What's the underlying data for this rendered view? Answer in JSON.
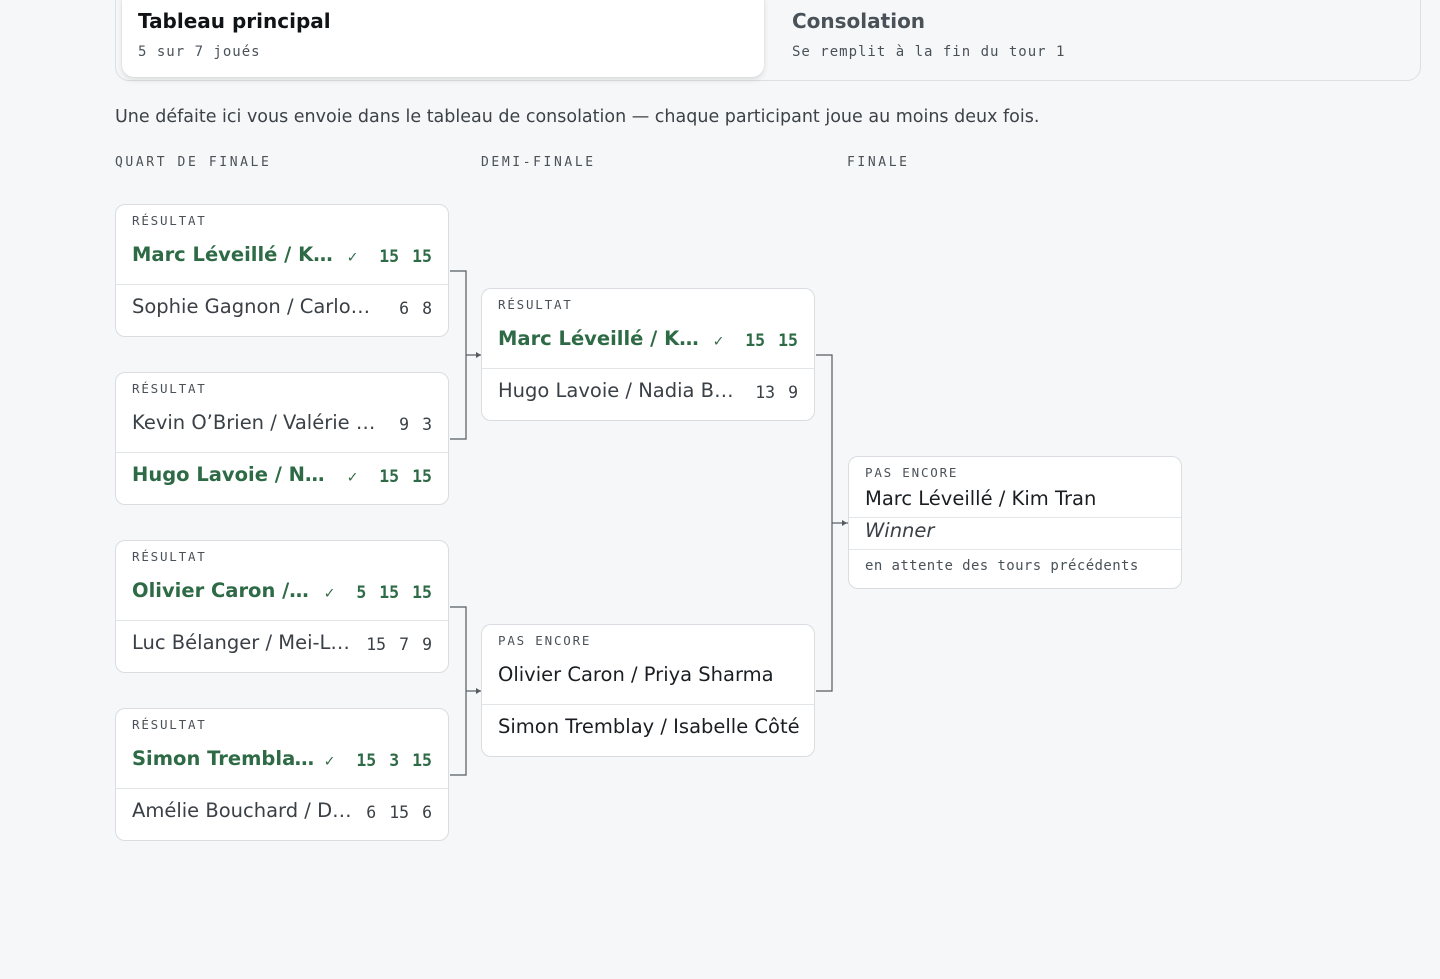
{
  "tabs": [
    {
      "title": "Tableau principal",
      "subtitle": "5 sur 7 joués"
    },
    {
      "title": "Consolation",
      "subtitle": "Se remplit à la fin du tour 1"
    }
  ],
  "note": "Une défaite ici vous envoie dans le tableau de consolation — chaque participant joue au moins deux fois.",
  "rounds": [
    "QUART DE FINALE",
    "DEMI-FINALE",
    "FINALE"
  ],
  "quarterfinals": [
    {
      "status": "RÉSULTAT",
      "team1": {
        "name": "Marc Léveillé / Kim Tran",
        "scores": [
          "15",
          "15"
        ],
        "winner": true
      },
      "team2": {
        "name": "Sophie Gagnon / Carlos …",
        "scores": [
          "6",
          "8"
        ],
        "winner": false
      }
    },
    {
      "status": "RÉSULTAT",
      "team1": {
        "name": "Kevin O’Brien / Valérie D…",
        "scores": [
          "9",
          "3"
        ],
        "winner": false
      },
      "team2": {
        "name": "Hugo Lavoie / Nadia Be…",
        "scores": [
          "15",
          "15"
        ],
        "winner": true
      }
    },
    {
      "status": "RÉSULTAT",
      "team1": {
        "name": "Olivier Caron / Priya Sharma",
        "scores": [
          "5",
          "15",
          "15"
        ],
        "winner": true
      },
      "team2": {
        "name": "Luc Bélanger / Mei-Li…",
        "scores": [
          "15",
          "7",
          "9"
        ],
        "winner": false
      }
    },
    {
      "status": "RÉSULTAT",
      "team1": {
        "name": "Simon Tremblay / Isabelle Côté",
        "scores": [
          "15",
          "3",
          "15"
        ],
        "winner": true
      },
      "team2": {
        "name": "Amélie Bouchard / De…",
        "scores": [
          "6",
          "15",
          "6"
        ],
        "winner": false
      }
    }
  ],
  "semifinals": [
    {
      "status": "RÉSULTAT",
      "team1": {
        "name": "Marc Léveillé / Kim Tran",
        "scores": [
          "15",
          "15"
        ],
        "winner": true
      },
      "team2": {
        "name": "Hugo Lavoie / Nadia Be…",
        "scores": [
          "13",
          "9"
        ],
        "winner": false
      }
    },
    {
      "status": "PAS ENCORE",
      "team1": {
        "name": "Olivier Caron / Priya Sharma"
      },
      "team2": {
        "name": "Simon Tremblay / Isabelle Côté"
      }
    }
  ],
  "final": {
    "status": "PAS ENCORE",
    "team1": "Marc Léveillé / Kim Tran",
    "team2": "Winner",
    "waiting": "en attente des tours précédents"
  },
  "icons": {
    "winner_mark": "check-icon"
  },
  "colors": {
    "winner": "#2d6a45",
    "background": "#f6f7f8",
    "card_border": "#d9dde1",
    "connector": "#555b61"
  }
}
